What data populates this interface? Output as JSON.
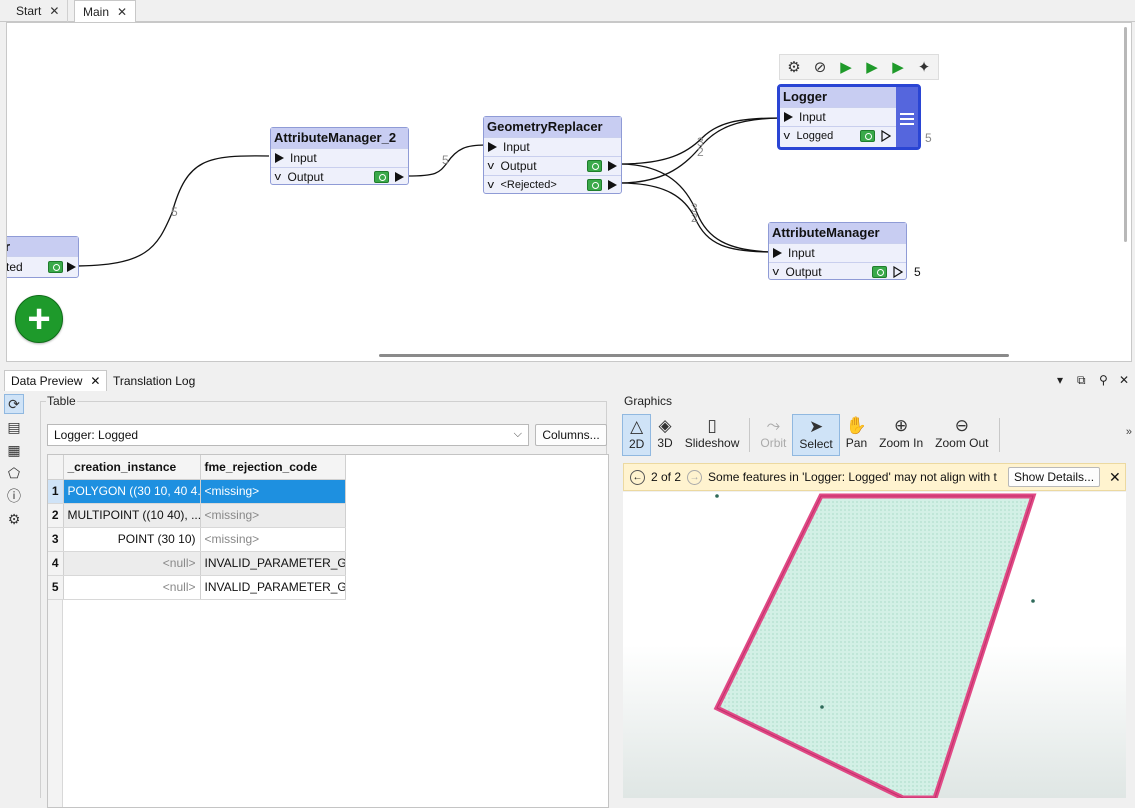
{
  "doc_tabs": [
    {
      "label": "Start",
      "active": false
    },
    {
      "label": "Main",
      "active": true
    }
  ],
  "close_glyph": "✕",
  "workspace": {
    "partial_node": {
      "title": "r",
      "port": "ted"
    },
    "attribute_manager_2": {
      "title": "AttributeManager_2",
      "input": "Input",
      "output": "Output"
    },
    "geometry_replacer": {
      "title": "GeometryReplacer",
      "input": "Input",
      "output": "Output",
      "rejected": "<Rejected>"
    },
    "logger": {
      "title": "Logger",
      "input": "Input",
      "logged": "Logged",
      "count": "5"
    },
    "attribute_manager": {
      "title": "AttributeManager",
      "input": "Input",
      "output": "Output",
      "count": "5"
    },
    "link_counts": {
      "a": "5",
      "b": "5",
      "c1": "3",
      "c2": "2",
      "d1": "3",
      "d2": "2"
    },
    "mini_toolbar_icons": [
      "gear-icon",
      "disable-icon",
      "run-to-this-icon",
      "run-from-this-icon",
      "run-just-this-icon",
      "sparkle-icon"
    ],
    "add_button_glyph": "+"
  },
  "pane_tabs": [
    {
      "label": "Data Preview",
      "active": true
    },
    {
      "label": "Translation Log",
      "active": false
    }
  ],
  "table_panel": {
    "group_label": "Table",
    "selector_value": "Logger: Logged",
    "columns_button": "Columns...",
    "columns": [
      "_creation_instance",
      "fme_rejection_code"
    ],
    "rows": [
      {
        "n": "1",
        "creation": "POLYGON ((30 10, 40 4...",
        "rejection": "<missing>"
      },
      {
        "n": "2",
        "creation": "MULTIPOINT ((10 40), ...",
        "rejection": "<missing>"
      },
      {
        "n": "3",
        "creation": "POINT (30 10)",
        "rejection": "<missing>"
      },
      {
        "n": "4",
        "creation": "<null>",
        "rejection": "INVALID_PARAMETER_G..."
      },
      {
        "n": "5",
        "creation": "<null>",
        "rejection": "INVALID_PARAMETER_G..."
      }
    ]
  },
  "graphics_panel": {
    "group_label": "Graphics",
    "toolbar": [
      {
        "label": "2D",
        "icon": "2d-icon",
        "on": true
      },
      {
        "label": "3D",
        "icon": "3d-icon",
        "on": false
      },
      {
        "label": "Slideshow",
        "icon": "slideshow-icon",
        "on": false
      },
      {
        "label": "Orbit",
        "icon": "orbit-icon",
        "disabled": true
      },
      {
        "label": "Select",
        "icon": "select-icon",
        "on": true
      },
      {
        "label": "Pan",
        "icon": "pan-icon",
        "on": false
      },
      {
        "label": "Zoom In",
        "icon": "zoom-in-icon",
        "on": false
      },
      {
        "label": "Zoom Out",
        "icon": "zoom-out-icon",
        "on": false
      }
    ],
    "notice": {
      "counter": "2 of 2",
      "message": "Some features in 'Logger: Logged' may not align with t",
      "button": "Show Details..."
    }
  },
  "colors": {
    "accent": "#1e90e0",
    "polygon_stroke": "#e04a86",
    "polygon_fill": "#c9ecdf",
    "transformer_header": "#c8cdf2",
    "selected_border": "#2a45d4",
    "add_green": "#1e9a2b"
  }
}
